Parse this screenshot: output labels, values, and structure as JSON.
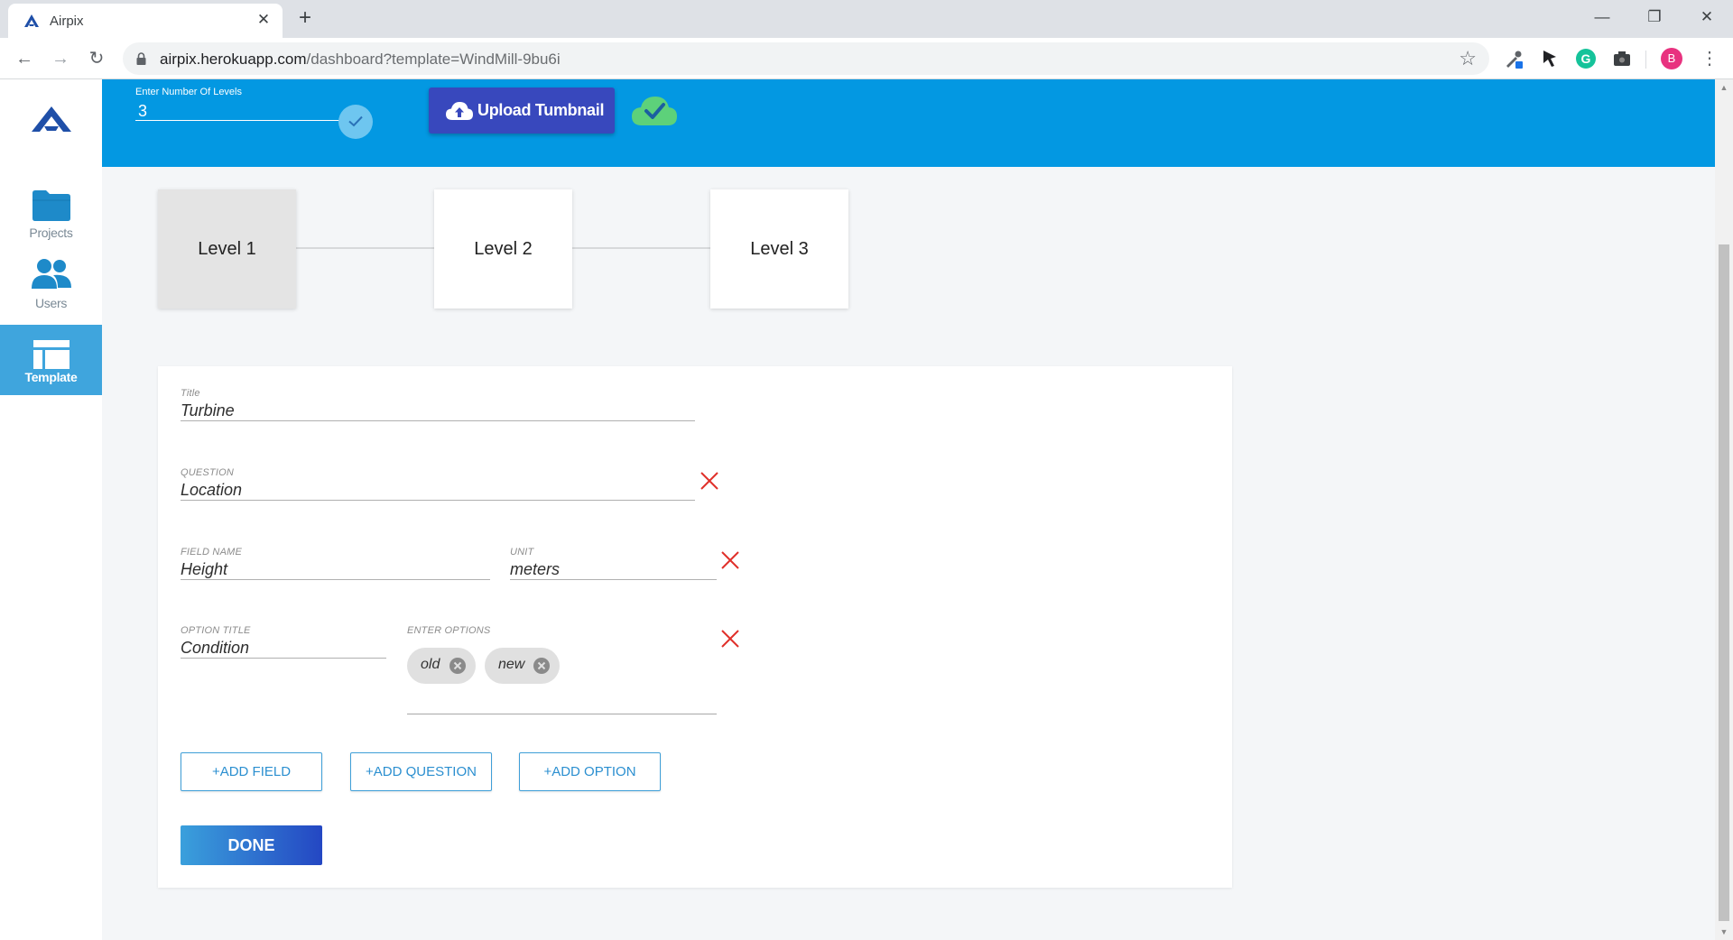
{
  "browser": {
    "tab_title": "Airpix",
    "url_host": "airpix.herokuapp.com",
    "url_path": "/dashboard?template=WindMill-9bu6i",
    "avatar_letter": "B",
    "minimize": "—",
    "maximize": "❐",
    "close": "✕",
    "tab_close": "✕",
    "new_tab": "+",
    "back": "←",
    "forward": "→",
    "reload": "↻",
    "star": "☆",
    "menu": "⋮"
  },
  "sidebar": {
    "items": [
      {
        "label": "Projects",
        "icon": "folder-icon"
      },
      {
        "label": "Users",
        "icon": "users-icon"
      },
      {
        "label": "Template",
        "icon": "template-icon",
        "active": true
      }
    ]
  },
  "header": {
    "levels_label": "Enter Number Of Levels",
    "levels_value": "3",
    "upload_label": "Upload Tumbnail"
  },
  "levels": [
    "Level 1",
    "Level 2",
    "Level 3"
  ],
  "form": {
    "title_label": "Title",
    "title_value": "Turbine",
    "question_label": "QUESTION",
    "question_value": "Location",
    "field_name_label": "FIELD NAME",
    "field_name_value": "Height",
    "unit_label": "UNIT",
    "unit_value": "meters",
    "option_title_label": "OPTION TITLE",
    "option_title_value": "Condition",
    "enter_options_label": "ENTER OPTIONS",
    "options": [
      "old",
      "new"
    ],
    "add_field": "+ADD FIELD",
    "add_question": "+ADD QUESTION",
    "add_option": "+ADD OPTION",
    "done": "DONE"
  },
  "colors": {
    "header_blue": "#0398e2",
    "upload_button": "#3848bd",
    "sidebar_active": "#3fa5dd",
    "delete_red": "#e0302a",
    "success_green": "#5dd17a"
  }
}
